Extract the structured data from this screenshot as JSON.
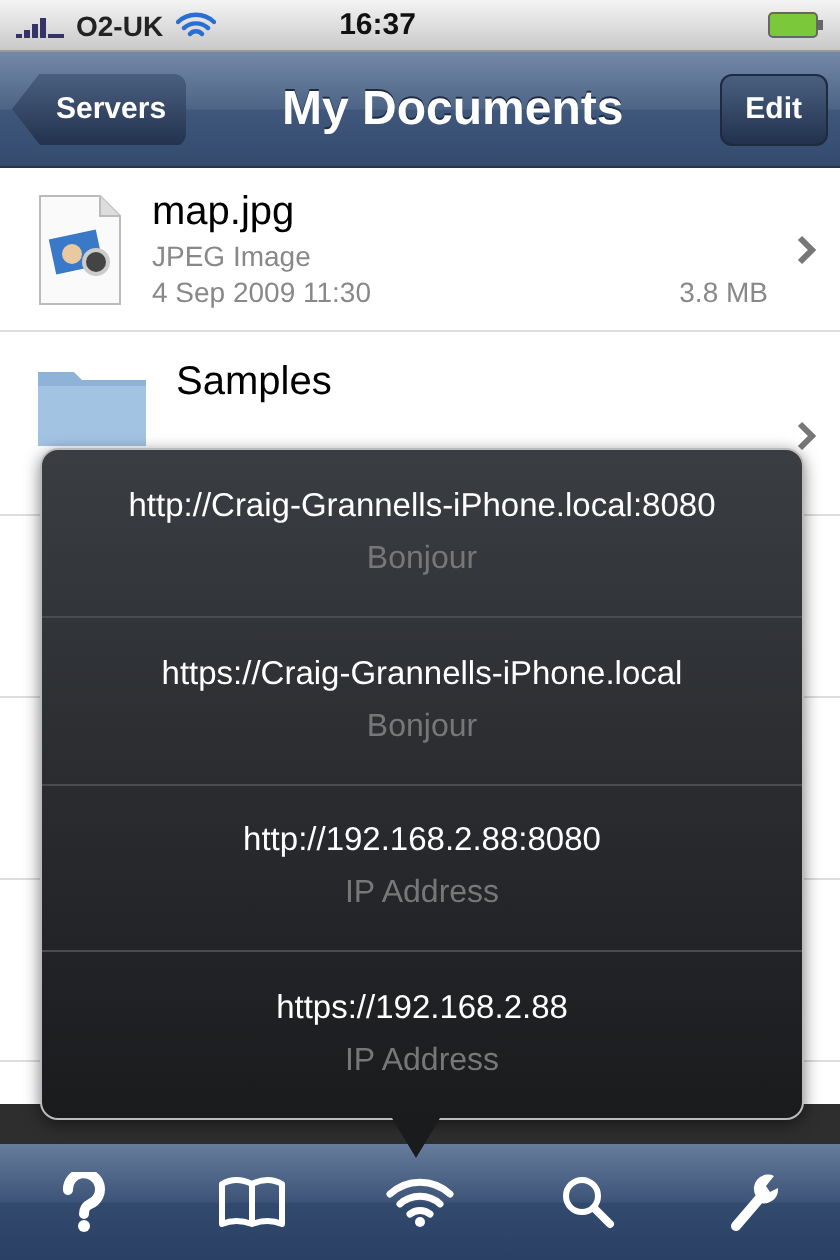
{
  "status_bar": {
    "carrier": "O2-UK",
    "time": "16:37"
  },
  "nav": {
    "back": "Servers",
    "title": "My Documents",
    "action": "Edit"
  },
  "files": [
    {
      "kind": "image",
      "name": "map.jpg",
      "type": "JPEG Image",
      "date": "4 Sep 2009 11:30",
      "size": "3.8 MB"
    },
    {
      "kind": "folder",
      "name": "Samples"
    }
  ],
  "popover": {
    "addresses": [
      {
        "url": "http://Craig-Grannells-iPhone.local:8080",
        "label": "Bonjour"
      },
      {
        "url": "https://Craig-Grannells-iPhone.local",
        "label": "Bonjour"
      },
      {
        "url": "http://192.168.2.88:8080",
        "label": "IP Address"
      },
      {
        "url": "https://192.168.2.88",
        "label": "IP Address"
      }
    ]
  },
  "toolbar": [
    {
      "kind": "help"
    },
    {
      "kind": "book"
    },
    {
      "kind": "wifi"
    },
    {
      "kind": "search"
    },
    {
      "kind": "wrench"
    }
  ]
}
